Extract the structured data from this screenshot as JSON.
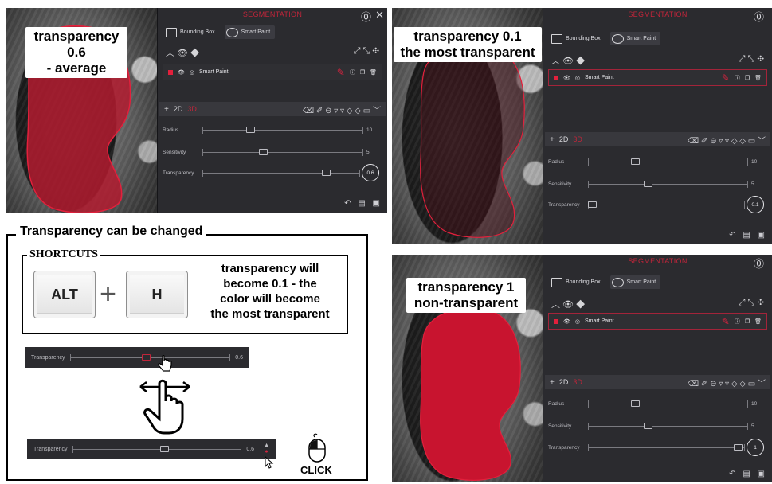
{
  "panels": {
    "top_left": {
      "caption": [
        "transparency 0.6",
        "- average"
      ],
      "transparency_value": "0.6"
    },
    "top_right": {
      "caption": [
        "transparency 0.1",
        "the most transparent"
      ],
      "transparency_value": "0.1"
    },
    "bottom_right": {
      "caption": [
        "transparency 1",
        "non-transparent"
      ],
      "transparency_value": "1"
    }
  },
  "segmentation": {
    "title": "SEGMENTATION",
    "help_icon": "help-circle-icon",
    "close_icon": "close-icon",
    "tabs": [
      {
        "label": "Bounding Box",
        "icon": "bounding-box-icon",
        "active": false
      },
      {
        "label": "Smart Paint",
        "icon": "smart-paint-icon",
        "active": true
      }
    ],
    "layer_name": "Smart Paint",
    "toolbar": {
      "add": "+",
      "d2": "2D",
      "d3": "3D"
    },
    "sliders": {
      "radius": {
        "label": "Radius",
        "value": "10",
        "level": 0.3
      },
      "sensitivity": {
        "label": "Sensitivity",
        "value": "5",
        "level": 0.38
      }
    },
    "transparency_label": "Transparency"
  },
  "instructions": {
    "heading": "Transparency can be changed",
    "shortcuts_heading": "SHORTCUTS",
    "key1": "ALT",
    "plus": "+",
    "key2": "H",
    "shortcut_description": [
      "transparency will",
      "become 0.1 - the",
      "color will become",
      "the most transparent"
    ],
    "mini_slider_1": {
      "label": "Transparency",
      "value": "0.6"
    },
    "mini_slider_2": {
      "label": "Transparency",
      "value": "0.6"
    },
    "click_label": "CLICK"
  },
  "colors": {
    "segmentation_red": "#d8233f",
    "panel_bg": "#2b2b2f",
    "accent": "#c0253a"
  }
}
